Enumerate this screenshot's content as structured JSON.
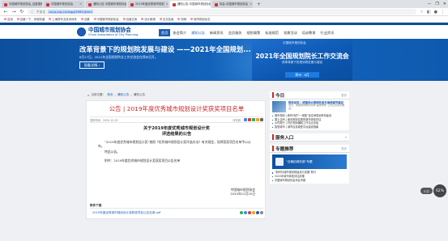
{
  "browser": {
    "tabs": [
      {
        "label": "中国城市规划协会_百度搜索",
        "active": false
      },
      {
        "label": "中国城市规划协会",
        "active": false
      },
      {
        "label": "通知公告-中国城市规划协会",
        "active": false
      },
      {
        "label": "2019年度优秀城市规划",
        "active": false
      },
      {
        "label": "通知公告-中国城市规划协会",
        "active": true
      },
      {
        "label": "协会-中国城市规划协会",
        "active": false
      }
    ],
    "new_tab": "+",
    "window_controls": [
      "—",
      "❐",
      "✕"
    ],
    "security_label": "不安全",
    "url": "cacp.org.cn/tzgg/3999.jhtml",
    "bookmarks": [
      "应用",
      "百度一下，你就知道",
      "上海院专业技术体系",
      "合集",
      "中国城市规划协会",
      "百度文库",
      "设计新闻",
      "论文检索",
      "知网",
      "城市规划杂志"
    ]
  },
  "site": {
    "logo_cn": "中国城市规划协会",
    "logo_en": "China Association of City Planning",
    "menu": [
      {
        "label": "首页",
        "state": "active"
      },
      {
        "label": "协会简介",
        "state": ""
      },
      {
        "label": "通知公告",
        "state": "sel"
      },
      {
        "label": "新闻资讯",
        "state": ""
      },
      {
        "label": "会员服务",
        "state": ""
      },
      {
        "label": "规划政策",
        "state": ""
      },
      {
        "label": "标准规范",
        "state": ""
      },
      {
        "label": "党建活动",
        "state": ""
      },
      {
        "label": "培训教育",
        "state": ""
      },
      {
        "label": "行业资讯",
        "state": ""
      }
    ]
  },
  "hero": {
    "title": "改革背景下的规划院发展与建设 ——2021年全国规划...",
    "subtitle": "6月17日，2021年全国规划院长工作交流会在郑州召开。",
    "button_label": "观看详情 ›",
    "card_header": "中国城市规划协会",
    "card_title": "2021年全国规划院长工作交流会",
    "card_subtitle": "改革背景下的规划院发展与建设",
    "card_button": "郑州 · 6月"
  },
  "breadcrumb": [
    "当前位置：",
    "首页",
    "通知公告",
    "通知公告"
  ],
  "article": {
    "title": "公告 | 2019年度优秀城市规划设计奖获奖项目名单",
    "date": "发布时间：2020-12-25",
    "share_label": "分享到：",
    "doc_title_1": "关于2019年度优秀城市规划设计奖",
    "doc_title_2": "评选结果的公告",
    "para1": "“2019年度优秀城市规划设计奖”按照《优秀城市规划设计奖评选办法》有关规定，现将获奖项目名单予以公布。",
    "para2": "特此公告。",
    "para3": "附件：2019年度优秀城市规划设计奖获奖项目公告名单",
    "sign_org": "中国城市规划协会",
    "sign_date": "2020年12月25日",
    "attach_head": "附件下载",
    "attach_file": "2019年度优秀城市规划设计奖获奖项目公告名单.pdf"
  },
  "sidebar": {
    "today_title": "今日",
    "more_label": "更多",
    "lead_title": "规划动态 | 城镇排水管网改造与海绵城市建设",
    "lead_desc": "近日，我国城市排水管网“提质增效”工作正在有序推进...",
    "news": [
      "城市规划 | 新时代的“一张图”及空间规划体系建设",
      "国土空间 | 面向规划实施的城市体检评估",
      "乡村振兴 | 村庄规划编制工作试点总结",
      "智慧城市 | 城市信息模型平台建设指南"
    ],
    "service_title": "服务入口",
    "topic_title": "专题推荐",
    "topic_promo": "“百篇旧城改造”专题",
    "topics": [
      "“新时代城市规划院建设与发展”研讨",
      "2020年城市体检评估成果",
      "中国城市规划协会年会专题"
    ]
  },
  "widget": {
    "value": "62%",
    "side_label": "S 中"
  }
}
